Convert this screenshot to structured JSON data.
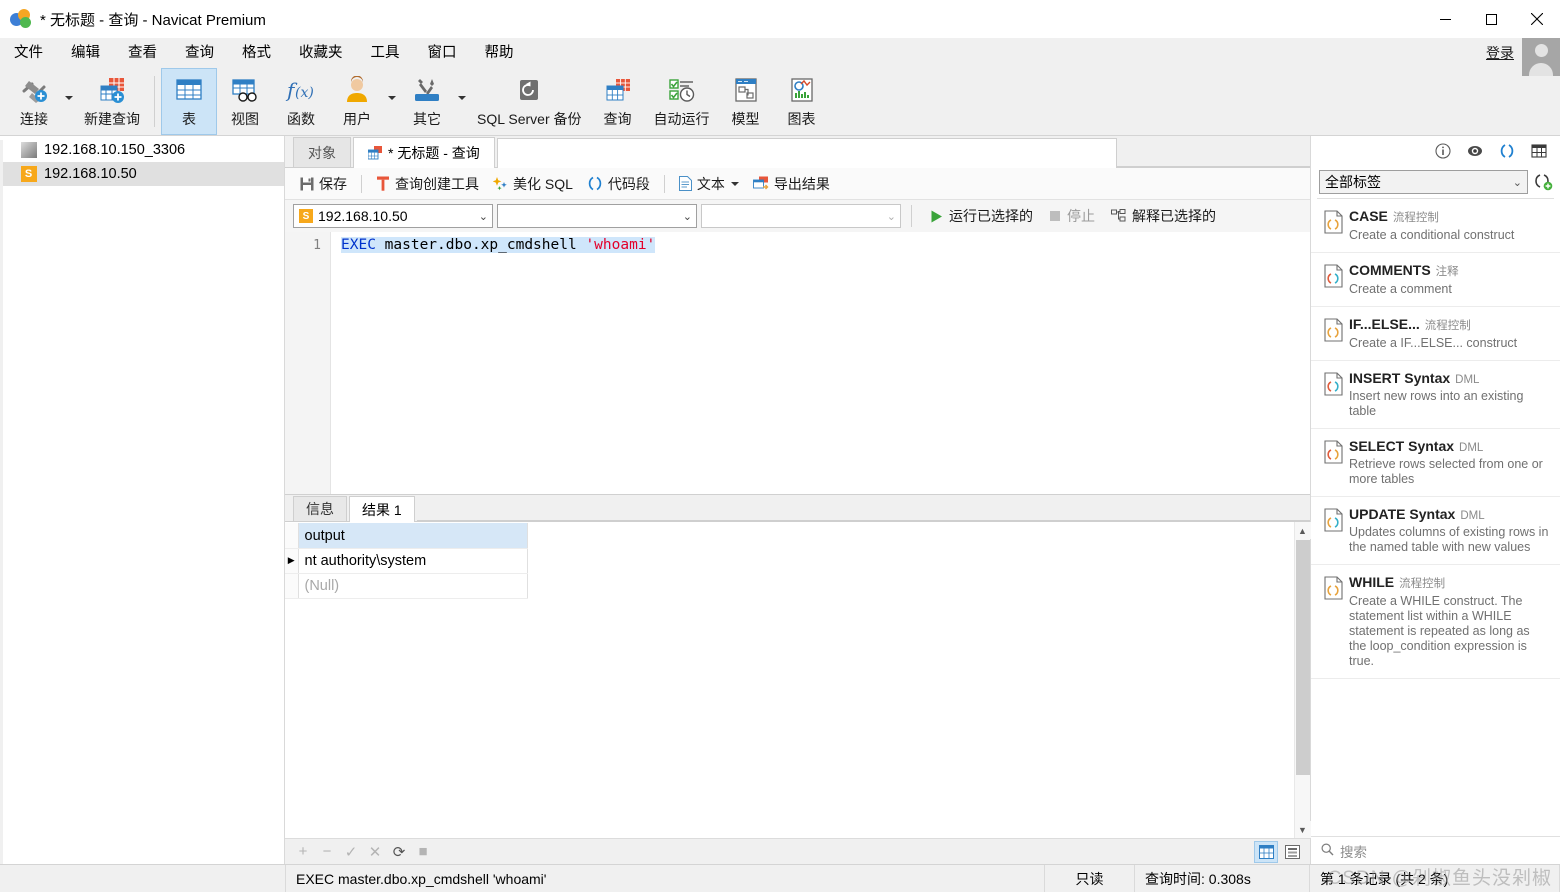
{
  "window": {
    "title": "* 无标题 - 查询 - Navicat Premium",
    "minimize_label": "最小化",
    "maximize_label": "最大化",
    "close_label": "关闭"
  },
  "menubar": {
    "items": [
      {
        "label": "文件",
        "name": "menu-file"
      },
      {
        "label": "编辑",
        "name": "menu-edit"
      },
      {
        "label": "查看",
        "name": "menu-view"
      },
      {
        "label": "查询",
        "name": "menu-query"
      },
      {
        "label": "格式",
        "name": "menu-format"
      },
      {
        "label": "收藏夹",
        "name": "menu-favorites"
      },
      {
        "label": "工具",
        "name": "menu-tools"
      },
      {
        "label": "窗口",
        "name": "menu-window"
      },
      {
        "label": "帮助",
        "name": "menu-help"
      }
    ],
    "login_label": "登录"
  },
  "ribbon": {
    "items": [
      {
        "label": "连接",
        "name": "ribbon-connection",
        "icon": "plug-plus-icon",
        "caret": true,
        "active": false
      },
      {
        "label": "新建查询",
        "name": "ribbon-new-query",
        "icon": "new-query-icon",
        "caret": false,
        "active": false
      },
      {
        "label": "表",
        "name": "ribbon-table",
        "icon": "table-icon",
        "caret": false,
        "active": true
      },
      {
        "label": "视图",
        "name": "ribbon-view",
        "icon": "view-icon",
        "caret": false,
        "active": false
      },
      {
        "label": "函数",
        "name": "ribbon-function",
        "icon": "function-fx-icon",
        "caret": false,
        "active": false
      },
      {
        "label": "用户",
        "name": "ribbon-user",
        "icon": "user-icon",
        "caret": true,
        "active": false
      },
      {
        "label": "其它",
        "name": "ribbon-other",
        "icon": "tools-icon",
        "caret": true,
        "active": false
      },
      {
        "label": "SQL Server 备份",
        "name": "ribbon-sqlserver-backup",
        "icon": "backup-icon",
        "caret": false,
        "active": false
      },
      {
        "label": "查询",
        "name": "ribbon-query",
        "icon": "query-icon",
        "caret": false,
        "active": false
      },
      {
        "label": "自动运行",
        "name": "ribbon-automation",
        "icon": "automation-icon",
        "caret": false,
        "active": false
      },
      {
        "label": "模型",
        "name": "ribbon-model",
        "icon": "model-icon",
        "caret": false,
        "active": false
      },
      {
        "label": "图表",
        "name": "ribbon-chart",
        "icon": "chart-icon",
        "caret": false,
        "active": false
      }
    ]
  },
  "sidebar": {
    "connections": [
      {
        "label": "192.168.10.150_3306",
        "type": "mysql",
        "selected": false
      },
      {
        "label": "192.168.10.50",
        "type": "sqlserver",
        "selected": true
      }
    ]
  },
  "tabs": [
    {
      "label": "对象",
      "name": "tab-objects",
      "active": false,
      "icon": false
    },
    {
      "label": "* 无标题 - 查询",
      "name": "tab-untitled-query",
      "active": true,
      "icon": true
    }
  ],
  "query_toolbar": {
    "save": "保存",
    "query_builder": "查询创建工具",
    "beautify_sql": "美化 SQL",
    "code_snippet": "代码段",
    "text": "文本",
    "export_result": "导出结果"
  },
  "connection_bar": {
    "connection": "192.168.10.50",
    "database": "",
    "schema": "",
    "run_selected": "运行已选择的",
    "stop": "停止",
    "explain_selected": "解释已选择的"
  },
  "editor": {
    "line_numbers": [
      "1"
    ],
    "sql_tokens": [
      {
        "text": "EXEC",
        "kind": "kw"
      },
      {
        "text": " master.dbo.xp_cmdshell ",
        "kind": "plain"
      },
      {
        "text": "'whoami'",
        "kind": "str"
      }
    ],
    "sql_text": "EXEC master.dbo.xp_cmdshell 'whoami'"
  },
  "result_tabs": [
    {
      "label": "信息",
      "name": "tab-messages",
      "active": false
    },
    {
      "label": "结果 1",
      "name": "tab-result-1",
      "active": true
    }
  ],
  "result_grid": {
    "columns": [
      "output"
    ],
    "rows": [
      {
        "marker": "▶",
        "values": [
          "nt authority\\system"
        ],
        "null": false
      },
      {
        "marker": "",
        "values": [
          "(Null)"
        ],
        "null": true
      }
    ]
  },
  "grid_footer": {
    "buttons": [
      {
        "name": "add-record-button",
        "glyph": "+",
        "enabled": false
      },
      {
        "name": "remove-record-button",
        "glyph": "−",
        "enabled": false
      },
      {
        "name": "apply-change-button",
        "glyph": "✓",
        "enabled": false
      },
      {
        "name": "cancel-change-button",
        "glyph": "✕",
        "enabled": false
      },
      {
        "name": "refresh-button",
        "glyph": "⟳",
        "enabled": true
      },
      {
        "name": "stop-button",
        "glyph": "■",
        "enabled": false
      }
    ],
    "grid_view_label": "网格查看",
    "form_view_label": "表单查看"
  },
  "right_panel": {
    "top_icons": [
      {
        "name": "info-icon",
        "title": "信息"
      },
      {
        "name": "preview-icon",
        "title": "预览"
      },
      {
        "name": "code-snippet-icon",
        "title": "代码段"
      },
      {
        "name": "structure-icon",
        "title": "结构"
      }
    ],
    "filter_value": "全部标签",
    "add_snippet_label": "新建代码段",
    "search_placeholder": "搜索",
    "snippets": [
      {
        "title": "CASE",
        "category": "流程控制",
        "description": "Create a conditional construct",
        "icon_color": "#e8a33d"
      },
      {
        "title": "COMMENTS",
        "category": "注释",
        "description": "Create a comment",
        "icon_color": "#e05c3c"
      },
      {
        "title": "IF...ELSE...",
        "category": "流程控制",
        "description": "Create a IF...ELSE... construct",
        "icon_color": "#e8a33d"
      },
      {
        "title": "INSERT Syntax",
        "category": "DML",
        "description": "Insert new rows into an existing table",
        "icon_color": "#e05c3c"
      },
      {
        "title": "SELECT Syntax",
        "category": "DML",
        "description": "Retrieve rows selected from one or more tables",
        "icon_color": "#e05c3c"
      },
      {
        "title": "UPDATE Syntax",
        "category": "DML",
        "description": "Updates columns of existing rows in the named table with new values",
        "icon_color": "#e05c3c"
      },
      {
        "title": "WHILE",
        "category": "流程控制",
        "description": "Create a WHILE construct. The statement list within a WHILE statement is repeated as long as the loop_condition expression is true.",
        "icon_color": "#e8a33d"
      }
    ]
  },
  "statusbar": {
    "sql": "EXEC master.dbo.xp_cmdshell 'whoami'",
    "readonly": "只读",
    "query_time": "查询时间: 0.308s",
    "record_info": "第 1 条记录 (共 2 条)"
  },
  "watermark": {
    "text": "CSDN @剁椒鱼头没剁椒"
  },
  "colors": {
    "accent": "#0078d7",
    "ribbon_active": "#cce4f7",
    "header_bg": "#d6e7f7",
    "selection": "#cfe6fb",
    "keyword": "#0033cc",
    "string": "#e3002a"
  }
}
